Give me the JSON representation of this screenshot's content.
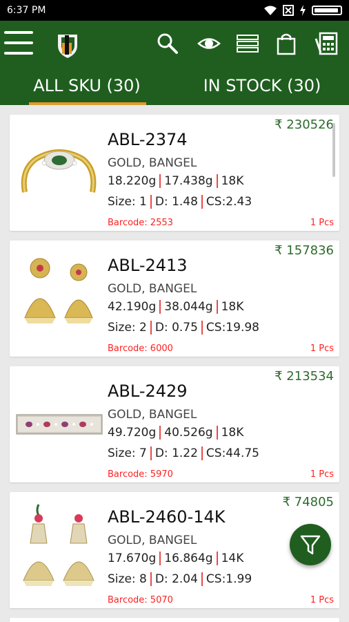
{
  "status_bar": {
    "time": "6:37 PM"
  },
  "app_bar": {
    "icons": [
      "menu-icon",
      "logo-icon",
      "search-icon",
      "eye-icon",
      "list-icon",
      "bag-icon",
      "calculator-icon"
    ]
  },
  "tabs": [
    {
      "label": "ALL SKU (30)",
      "active": true
    },
    {
      "label": "IN STOCK (30)",
      "active": false
    }
  ],
  "products": [
    {
      "price": "₹ 230526",
      "sku": "ABL-2374",
      "type": "GOLD, BANGEL",
      "gross_weight": "18.220g",
      "net_weight": "17.438g",
      "karat": "18K",
      "size": "Size: 1",
      "diamond": "D: 1.48",
      "cs": "CS:2.43",
      "barcode": "Barcode: 2553",
      "pcs": "1 Pcs",
      "image": "bangle"
    },
    {
      "price": "₹ 157836",
      "sku": "ABL-2413",
      "type": "GOLD, BANGEL",
      "gross_weight": "42.190g",
      "net_weight": "38.044g",
      "karat": "18K",
      "size": "Size: 2",
      "diamond": "D: 0.75",
      "cs": "CS:19.98",
      "barcode": "Barcode: 6000",
      "pcs": "1 Pcs",
      "image": "jhumka"
    },
    {
      "price": "₹ 213534",
      "sku": "ABL-2429",
      "type": "GOLD, BANGEL",
      "gross_weight": "49.720g",
      "net_weight": "40.526g",
      "karat": "18K",
      "size": "Size: 7",
      "diamond": "D: 1.22",
      "cs": "CS:44.75",
      "barcode": "Barcode: 5970",
      "pcs": "1 Pcs",
      "image": "bracelet"
    },
    {
      "price": "₹ 74805",
      "sku": "ABL-2460-14K",
      "type": "GOLD, BANGEL",
      "gross_weight": "17.670g",
      "net_weight": "16.864g",
      "karat": "14K",
      "size": "Size: 8",
      "diamond": "D: 2.04",
      "cs": "CS:1.99",
      "barcode": "Barcode: 5070",
      "pcs": "1 Pcs",
      "image": "jhumka"
    }
  ],
  "colors": {
    "primary": "#1f5e1f",
    "accent": "#e39a2b",
    "price": "#2d6b2d",
    "barcode": "#ff1f1f",
    "separator": "#e64a4a"
  },
  "fab": {
    "icon": "filter-icon"
  }
}
